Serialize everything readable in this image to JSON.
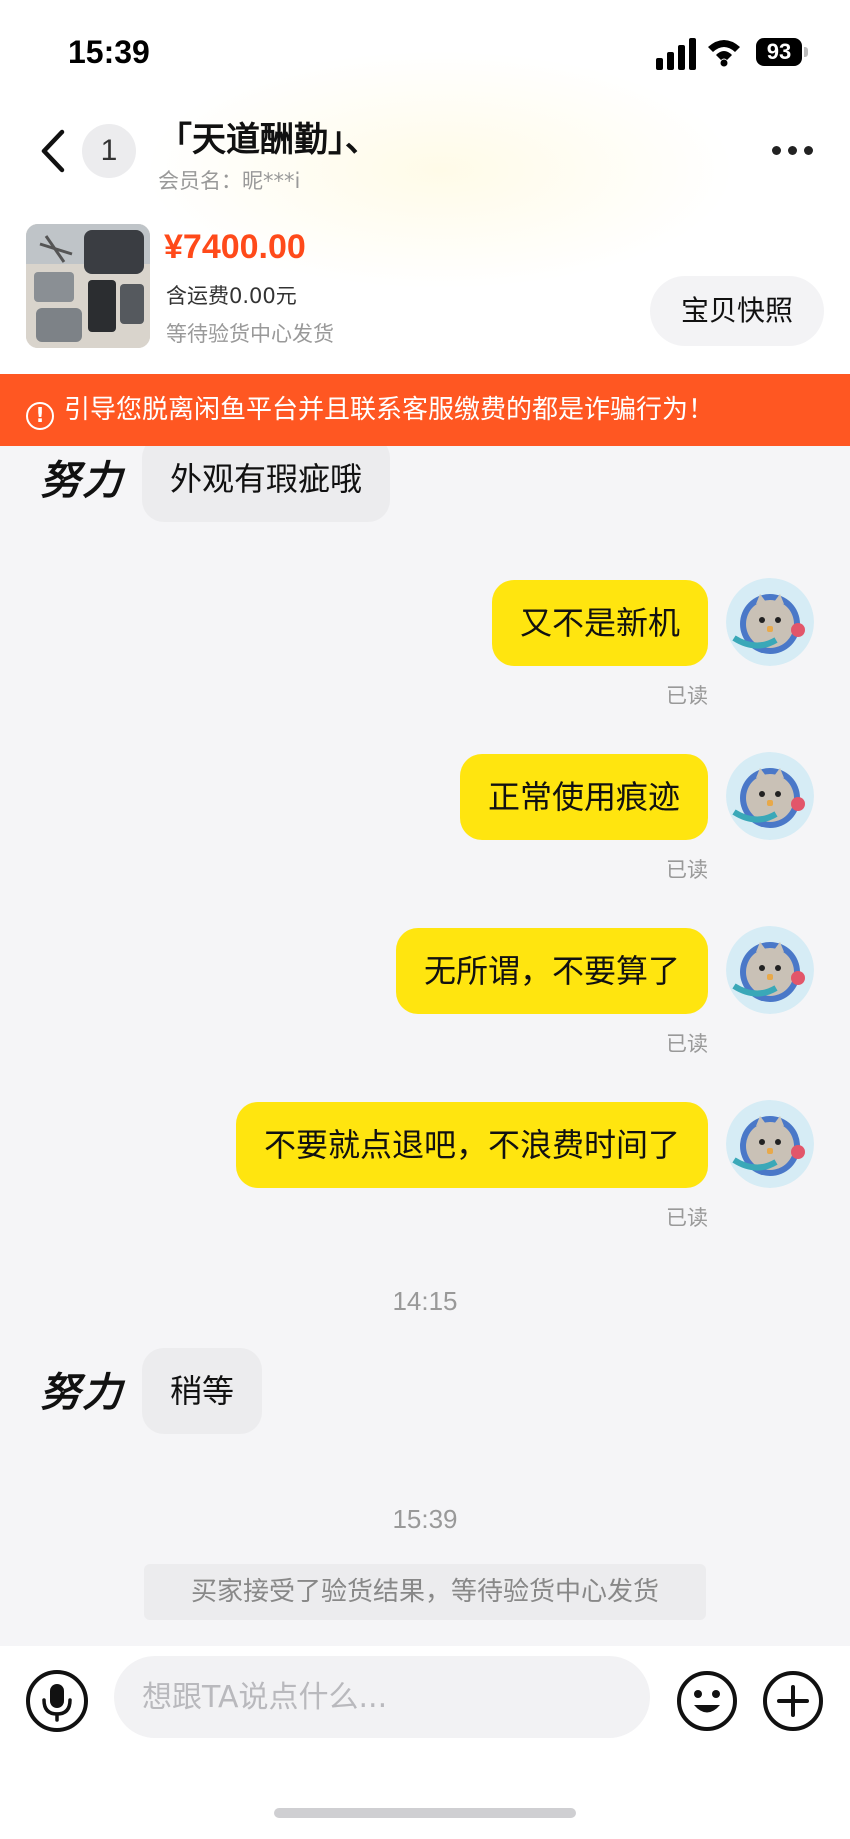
{
  "status_bar": {
    "time": "15:39",
    "battery": "93"
  },
  "header": {
    "unread_count": "1",
    "title": "「天道酬勤」、",
    "member_name": "会员名：昵***i"
  },
  "product": {
    "price": "¥7400.00",
    "shipping": "含运费0.00元",
    "status": "等待验货中心发货",
    "snapshot_label": "宝贝快照"
  },
  "warning": {
    "text": "引导您脱离闲鱼平台并且联系客服缴费的都是诈骗行为！"
  },
  "chat": {
    "sender_name": "努力",
    "messages": [
      {
        "from": "other",
        "text": "外观有瑕疵哦"
      },
      {
        "from": "me",
        "text": "又不是新机",
        "read": "已读"
      },
      {
        "from": "me",
        "text": "正常使用痕迹",
        "read": "已读"
      },
      {
        "from": "me",
        "text": "无所谓，不要算了",
        "read": "已读"
      },
      {
        "from": "me",
        "text": "不要就点退吧，不浪费时间了",
        "read": "已读"
      }
    ],
    "time_1": "14:15",
    "message_after_1": {
      "from": "other",
      "text": "稍等"
    },
    "time_2": "15:39",
    "system_notice": "买家接受了验货结果，等待验货中心发货"
  },
  "input": {
    "placeholder": "想跟TA说点什么..."
  },
  "icons": [
    "back-arrow-icon",
    "more-dots-icon",
    "warning-circle-icon",
    "microphone-icon",
    "emoji-icon",
    "plus-icon",
    "signal-icon",
    "wifi-icon",
    "battery-icon"
  ],
  "colors": {
    "accent_yellow": "#ffe50f",
    "price_red": "#ff4a1a",
    "warning_orange": "#ff5722"
  }
}
